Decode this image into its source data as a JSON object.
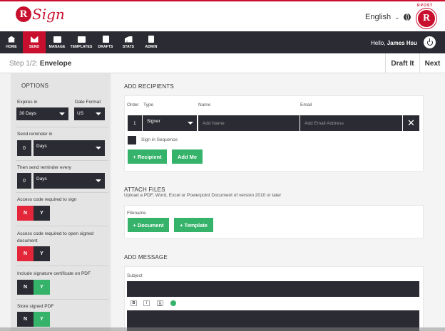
{
  "header": {
    "brand_letter": "R",
    "brand_text": "Sign",
    "language": "English",
    "badge_letter": "R",
    "badge_text": "RPOST"
  },
  "nav": {
    "items": [
      {
        "label": "HOME"
      },
      {
        "label": "SEND"
      },
      {
        "label": "MANAGE"
      },
      {
        "label": "TEMPLATES"
      },
      {
        "label": "DRAFTS"
      },
      {
        "label": "STATS"
      },
      {
        "label": "ADMIN"
      }
    ],
    "greeting": "Hello,",
    "user_name": "James Hsu"
  },
  "stepbar": {
    "step": "Step 1/2:",
    "step_name": "Envelope",
    "draft_label": "Draft It",
    "next_label": "Next"
  },
  "options": {
    "title": "OPTIONS",
    "expires_label": "Expires in",
    "expires_value": "30 Days",
    "date_format_label": "Date Format",
    "date_format_value": "US",
    "reminder_label": "Send reminder in",
    "reminder_number": "0",
    "reminder_unit": "Days",
    "repeat_label": "Then send reminder every",
    "repeat_number": "0",
    "repeat_unit": "Days",
    "access_sign_label": "Access code required to sign",
    "access_open_label": "Access code required to open signed document",
    "cert_label": "Include signature certificate on PDF",
    "store_label": "Store signed PDF",
    "no": "N",
    "yes": "Y"
  },
  "recipients": {
    "title": "ADD RECIPIENTS",
    "col_order": "Order",
    "col_type": "Type",
    "col_name": "Name",
    "col_email": "Email",
    "row_order": "1",
    "row_type": "Signer",
    "name_placeholder": "Add Name",
    "email_placeholder": "Add Email Address",
    "sequence_label": "Sign in Sequence",
    "add_recipient": "+ Recipient",
    "add_me": "Add Me"
  },
  "files": {
    "title": "ATTACH FILES",
    "subtitle": "Upload a PDF, Word, Excel or Powerpoint Document of version 2010 or later",
    "filename_label": "Filename",
    "add_document": "+ Document",
    "add_template": "+ Template"
  },
  "message": {
    "title": "ADD MESSAGE",
    "subject_label": "Subject",
    "bold": "B",
    "italic": "I",
    "underline": "U"
  }
}
